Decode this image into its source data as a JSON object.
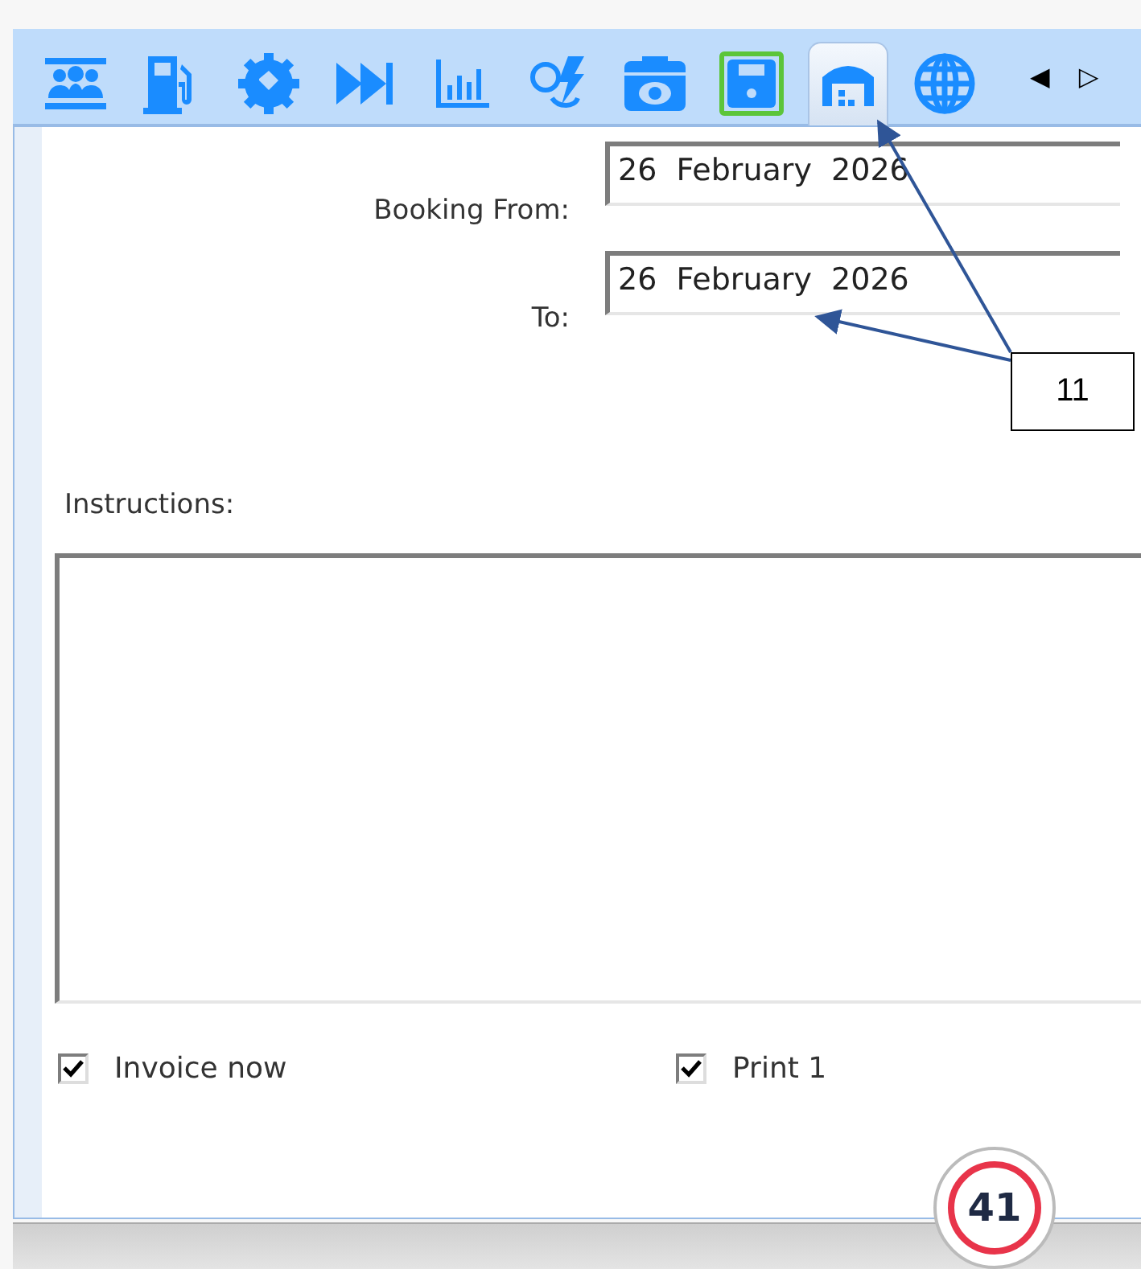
{
  "toolbar": {
    "tabs": [
      {
        "kind": "people",
        "selected": false,
        "highlighted": false
      },
      {
        "kind": "fuel",
        "selected": false,
        "highlighted": false
      },
      {
        "kind": "gear",
        "selected": false,
        "highlighted": false
      },
      {
        "kind": "forward",
        "selected": false,
        "highlighted": false
      },
      {
        "kind": "chart",
        "selected": false,
        "highlighted": false
      },
      {
        "kind": "money",
        "selected": false,
        "highlighted": false
      },
      {
        "kind": "camera",
        "selected": false,
        "highlighted": false
      },
      {
        "kind": "save",
        "selected": false,
        "highlighted": true
      },
      {
        "kind": "garage",
        "selected": true,
        "highlighted": false
      },
      {
        "kind": "globe",
        "selected": false,
        "highlighted": false
      }
    ],
    "scroll_left": "◀",
    "scroll_right": "▷"
  },
  "form": {
    "booking_from": {
      "label": "Booking From:",
      "value": "26  February  2026"
    },
    "to": {
      "label": "To:",
      "value": "26  February  2026"
    },
    "instructions": {
      "label": "Instructions:"
    },
    "checkboxes": [
      {
        "label": "Invoice now",
        "checked": true
      },
      {
        "label": "Print 1",
        "checked": true
      }
    ]
  },
  "callout": {
    "label": "11"
  },
  "badge": {
    "count": "41"
  }
}
